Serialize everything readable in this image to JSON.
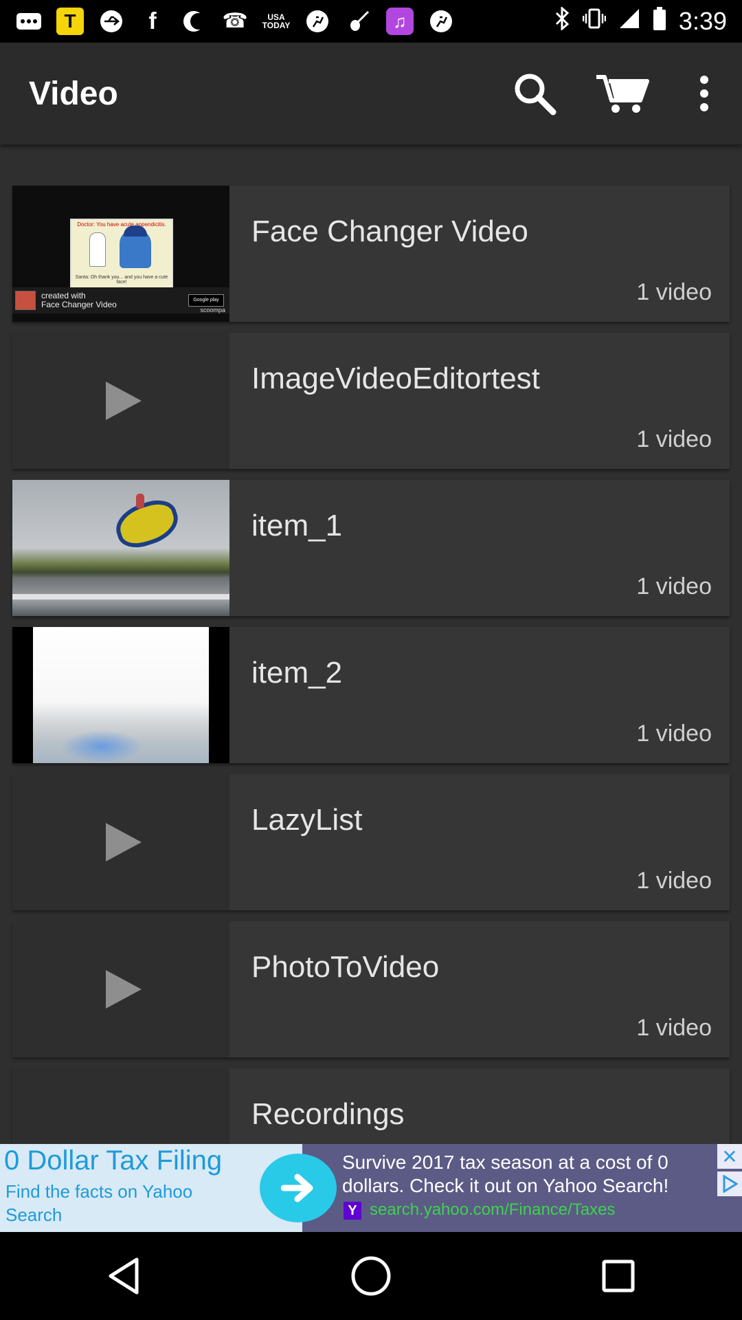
{
  "status_bar": {
    "time": "3:39",
    "icons": [
      "photos-icon",
      "tinder-icon",
      "usb-icon",
      "facebook-icon",
      "moon-icon",
      "phone-icon",
      "usa-today-icon",
      "fitness-icon",
      "violin-icon",
      "music-icon",
      "fitness-icon",
      "bluetooth-icon",
      "vibrate-icon",
      "signal-icon",
      "battery-icon"
    ],
    "usa_today_label": "USA TODAY"
  },
  "app_bar": {
    "title": "Video",
    "actions": [
      "search-icon",
      "cart-icon",
      "more-vert-icon"
    ]
  },
  "list": {
    "items": [
      {
        "title": "Face Changer Video",
        "count": "1 video",
        "thumb": "face-changer"
      },
      {
        "title": "ImageVideoEditortest",
        "count": "1 video",
        "thumb": "placeholder"
      },
      {
        "title": "item_1",
        "count": "1 video",
        "thumb": "item1"
      },
      {
        "title": "item_2",
        "count": "1 video",
        "thumb": "item2"
      },
      {
        "title": "LazyList",
        "count": "1 video",
        "thumb": "placeholder"
      },
      {
        "title": "PhotoToVideo",
        "count": "1 video",
        "thumb": "placeholder"
      },
      {
        "title": "Recordings",
        "count": "",
        "thumb": "placeholder"
      }
    ],
    "face_thumb": {
      "caption_top": "Doctor: You have acute appendicitis.",
      "caption_bottom": "Santa: Oh thank you... and you have a cute face!",
      "footer_text_1": "created with",
      "footer_text_2": "Face Changer Video",
      "store_badge": "Google play",
      "brand": "scoompa"
    }
  },
  "ad": {
    "headline": "0 Dollar Tax Filing",
    "subtext": "Find the facts on Yahoo Search",
    "body": "Survive 2017 tax season at a cost of 0 dollars. Check it out on Yahoo Search!",
    "yahoo_mark": "Y",
    "url": "search.yahoo.com/Finance/Taxes",
    "close_glyph": "✕"
  },
  "nav_bar": {
    "buttons": [
      "back-icon",
      "home-icon",
      "recents-icon"
    ]
  }
}
